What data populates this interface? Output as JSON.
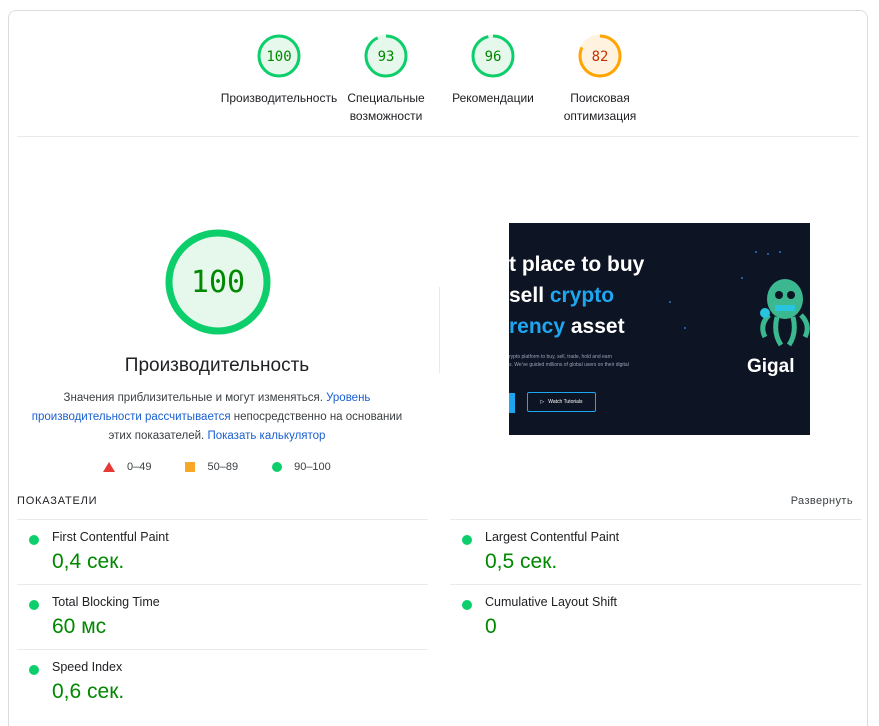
{
  "top_scores": [
    {
      "score": "100",
      "label": "Производительность",
      "color": "#0cce6b",
      "text_color": "#008800",
      "fill": "#e6f7ec",
      "value": 100
    },
    {
      "score": "93",
      "label": "Специальные возможности",
      "color": "#0cce6b",
      "text_color": "#008800",
      "fill": "#e6f7ec",
      "value": 93
    },
    {
      "score": "96",
      "label": "Рекомендации",
      "color": "#0cce6b",
      "text_color": "#008800",
      "fill": "#e6f7ec",
      "value": 96
    },
    {
      "score": "82",
      "label": "Поисковая оптимизация",
      "color": "#ffa400",
      "text_color": "#c33300",
      "fill": "#fff3e0",
      "value": 82
    }
  ],
  "main": {
    "score": "100",
    "title": "Производительность",
    "desc_part1": "Значения приблизительные и могут изменяться. ",
    "desc_link1": "Уровень производительности рассчитывается",
    "desc_part2": " непосредственно на основании этих показателей. ",
    "desc_link2": "Показать калькулятор"
  },
  "legend": [
    {
      "shape": "triangle",
      "range": "0–49"
    },
    {
      "shape": "square",
      "range": "50–89"
    },
    {
      "shape": "circle",
      "range": "90–100"
    }
  ],
  "screenshot": {
    "line1": "t place to buy",
    "line2_a": " sell ",
    "line2_b": "crypto",
    "line3_a": "rency",
    "line3_b": " asset",
    "small1": "rypto platform to buy, sell, trade, hold and earn",
    "small2": "s. We've guided millions of global users on their digital",
    "watch": "Watch Tutorials",
    "brand": "Gigal"
  },
  "metrics": {
    "header": "ПОКАЗАТЕЛИ",
    "expand": "Развернуть",
    "items": [
      {
        "name": "First Contentful Paint",
        "value": "0,4 сек."
      },
      {
        "name": "Largest Contentful Paint",
        "value": "0,5 сек."
      },
      {
        "name": "Total Blocking Time",
        "value": "60 мс"
      },
      {
        "name": "Cumulative Layout Shift",
        "value": "0"
      },
      {
        "name": "Speed Index",
        "value": "0,6 сек."
      }
    ]
  },
  "colors": {
    "pass": "#0cce6b",
    "average": "#ffa400",
    "fail": "#e53935",
    "link": "#1a5fd0",
    "accent_text": "#008800"
  }
}
